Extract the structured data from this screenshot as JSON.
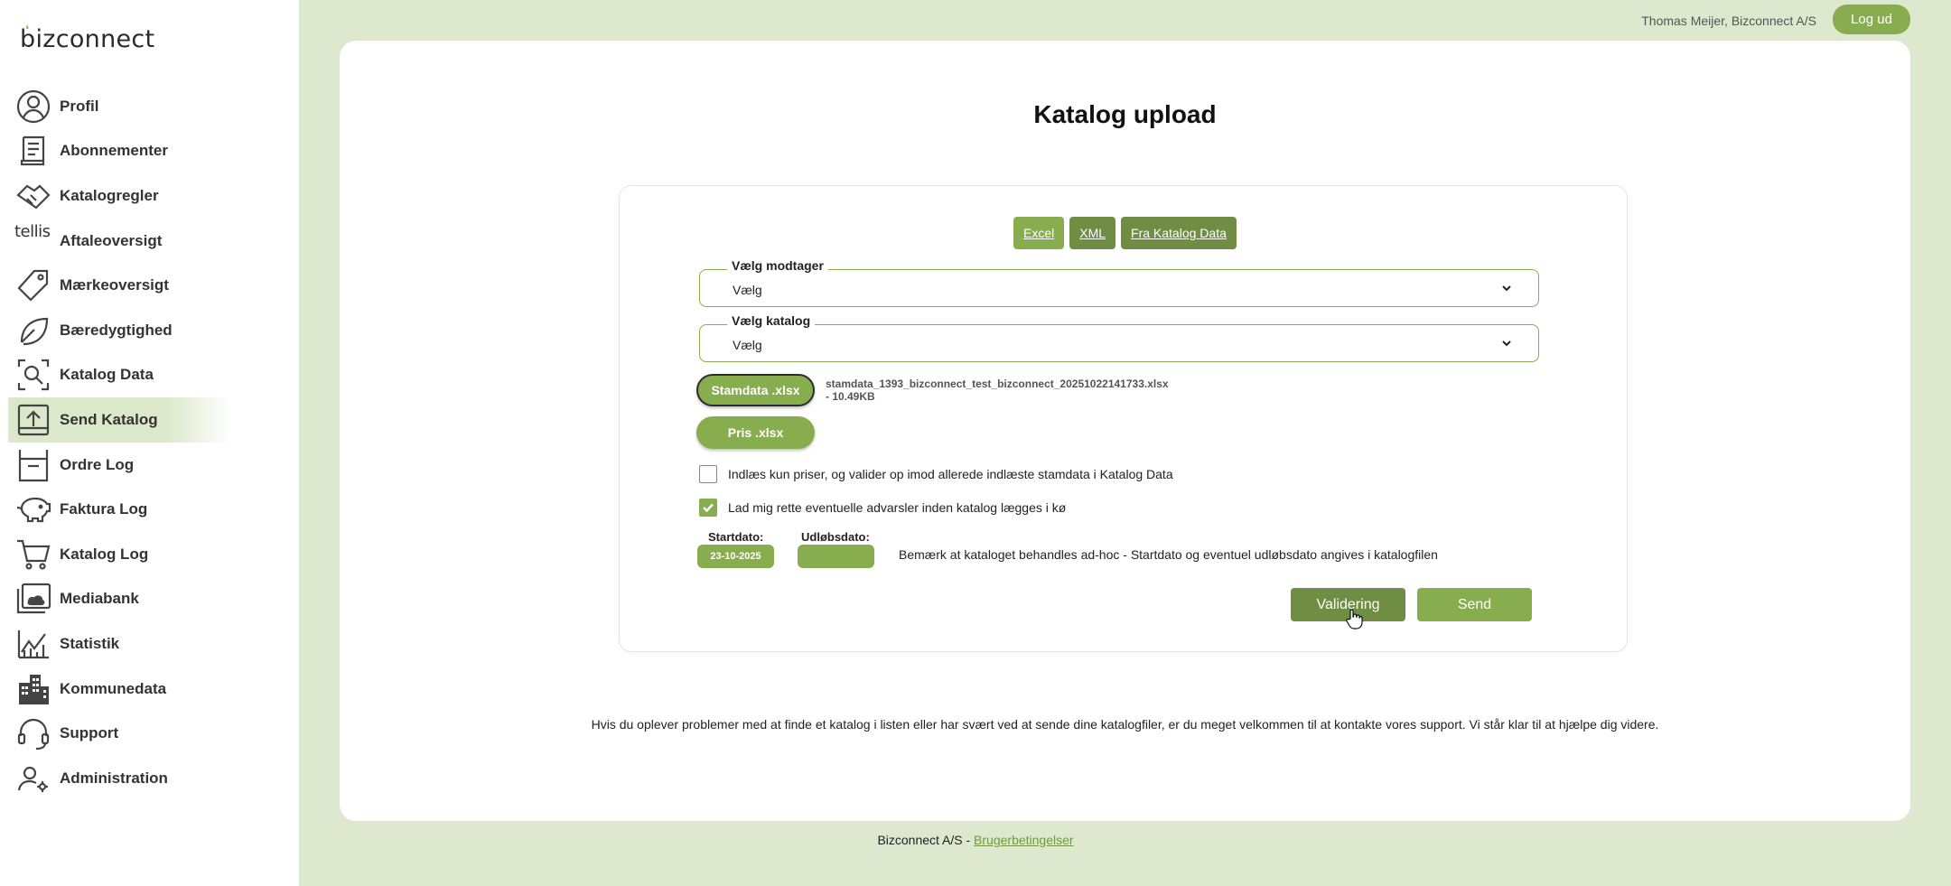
{
  "brand": {
    "logo_text": "bizconnect",
    "accent_color": "#88ad4f",
    "dark_accent_color": "#6f8e44"
  },
  "sidebar": {
    "items": [
      {
        "label": "Profil",
        "icon": "user-circle-icon"
      },
      {
        "label": "Abonnementer",
        "icon": "document-scroll-icon"
      },
      {
        "label": "Katalogregler",
        "icon": "handshake-icon"
      },
      {
        "label": "Aftaleoversigt",
        "icon": "tellis-logo",
        "mark": "tellis"
      },
      {
        "label": "Mærkeoversigt",
        "icon": "tag-icon"
      },
      {
        "label": "Bæredygtighed",
        "icon": "leaf-icon"
      },
      {
        "label": "Katalog Data",
        "icon": "search-frame-icon"
      },
      {
        "label": "Send Katalog",
        "icon": "upload-box-icon",
        "active": true
      },
      {
        "label": "Ordre Log",
        "icon": "inbox-icon"
      },
      {
        "label": "Faktura Log",
        "icon": "piggy-bank-icon"
      },
      {
        "label": "Katalog Log",
        "icon": "cart-icon"
      },
      {
        "label": "Mediabank",
        "icon": "folder-image-icon"
      },
      {
        "label": "Statistik",
        "icon": "line-chart-icon"
      },
      {
        "label": "Kommunedata",
        "icon": "buildings-icon"
      },
      {
        "label": "Support",
        "icon": "headset-icon"
      },
      {
        "label": "Administration",
        "icon": "user-settings-icon"
      }
    ]
  },
  "header": {
    "user": "Thomas Meijer, Bizconnect A/S",
    "logout_label": "Log ud"
  },
  "main": {
    "title": "Katalog upload",
    "format_tabs": [
      "Excel",
      "XML",
      "Fra Katalog Data"
    ],
    "recipient": {
      "legend": "Vælg modtager",
      "value": "Vælg"
    },
    "catalog": {
      "legend": "Vælg katalog",
      "value": "Vælg"
    },
    "stamdata_button": "Stamdata .xlsx",
    "pris_button": "Pris .xlsx",
    "file_name": "stamdata_1393_bizconnect_test_bizconnect_20251022141733.xlsx",
    "file_size": "- 10.49KB",
    "option_prices_only": {
      "label": "Indlæs kun priser, og valider op imod allerede indlæste stamdata i Katalog Data",
      "checked": false
    },
    "option_fix_warnings": {
      "label": "Lad mig rette eventuelle advarsler inden katalog lægges i kø",
      "checked": true
    },
    "start_date_label": "Startdato:",
    "start_date_value": "23-10-2025",
    "expiry_date_label": "Udløbsdato:",
    "expiry_date_value": "",
    "date_note": "Bemærk at kataloget behandles ad-hoc - Startdato og eventuel udløbsdato angives i katalogfilen",
    "validate_label": "Validering",
    "send_label": "Send",
    "support_note": "Hvis du oplever problemer med at finde et katalog i listen eller har svært ved at sende dine katalogfiler, er du meget velkommen til at kontakte vores support. Vi står klar til at hjælpe dig videre."
  },
  "footer": {
    "company": "Bizconnect A/S -",
    "terms_link": "Brugerbetingelser"
  }
}
